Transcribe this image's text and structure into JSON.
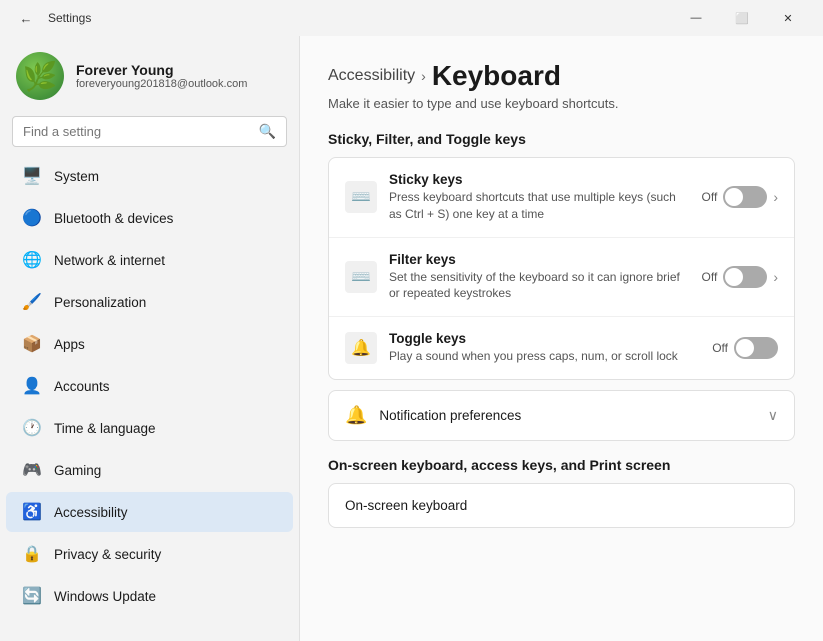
{
  "window": {
    "title": "Settings",
    "minimize_label": "—",
    "maximize_label": "⬜",
    "close_label": "✕"
  },
  "user": {
    "name": "Forever Young",
    "email": "foreveryoung201818@outlook.com"
  },
  "search": {
    "placeholder": "Find a setting"
  },
  "nav": {
    "items": [
      {
        "id": "system",
        "label": "System",
        "icon": "🖥️",
        "active": false
      },
      {
        "id": "bluetooth",
        "label": "Bluetooth & devices",
        "icon": "🔵",
        "active": false
      },
      {
        "id": "network",
        "label": "Network & internet",
        "icon": "🌐",
        "active": false
      },
      {
        "id": "personalization",
        "label": "Personalization",
        "icon": "🖌️",
        "active": false
      },
      {
        "id": "apps",
        "label": "Apps",
        "icon": "📦",
        "active": false
      },
      {
        "id": "accounts",
        "label": "Accounts",
        "icon": "👤",
        "active": false
      },
      {
        "id": "time",
        "label": "Time & language",
        "icon": "🕐",
        "active": false
      },
      {
        "id": "gaming",
        "label": "Gaming",
        "icon": "🎮",
        "active": false
      },
      {
        "id": "accessibility",
        "label": "Accessibility",
        "icon": "♿",
        "active": true
      },
      {
        "id": "privacy",
        "label": "Privacy & security",
        "icon": "🔒",
        "active": false
      },
      {
        "id": "update",
        "label": "Windows Update",
        "icon": "🔄",
        "active": false
      }
    ]
  },
  "content": {
    "breadcrumb_parent": "Accessibility",
    "breadcrumb_chevron": "›",
    "breadcrumb_current": "Keyboard",
    "subtitle": "Make it easier to type and use keyboard shortcuts.",
    "section1_heading": "Sticky, Filter, and Toggle keys",
    "rows": [
      {
        "id": "sticky-keys",
        "title": "Sticky keys",
        "desc": "Press keyboard shortcuts that use multiple keys (such as Ctrl + S) one key at a time",
        "toggle_state": "off",
        "toggle_label": "Off",
        "has_chevron": true,
        "icon": "⌨️"
      },
      {
        "id": "filter-keys",
        "title": "Filter keys",
        "desc": "Set the sensitivity of the keyboard so it can ignore brief or repeated keystrokes",
        "toggle_state": "off",
        "toggle_label": "Off",
        "has_chevron": true,
        "icon": "⌨️"
      },
      {
        "id": "toggle-keys",
        "title": "Toggle keys",
        "desc": "Play a sound when you press caps, num, or scroll lock",
        "toggle_state": "off",
        "toggle_label": "Off",
        "has_chevron": false,
        "icon": "🔔"
      }
    ],
    "notification_row": {
      "label": "Notification preferences",
      "icon": "🔔"
    },
    "section2_heading": "On-screen keyboard, access keys, and Print screen",
    "section2_row": {
      "label": "On-screen keyboard"
    }
  }
}
